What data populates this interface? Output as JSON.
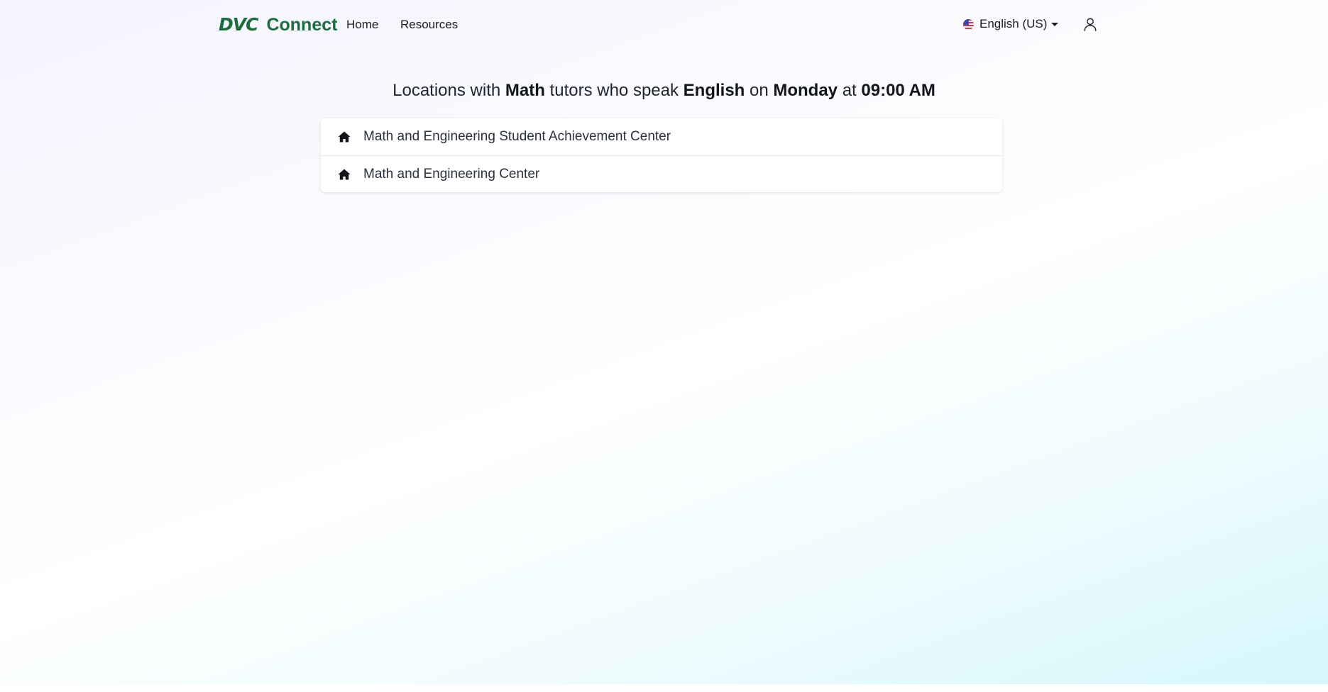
{
  "header": {
    "logo_text": "DVC",
    "brand_name": "Connect",
    "nav": {
      "home": "Home",
      "resources": "Resources"
    },
    "language": {
      "label": "English (US)",
      "flag_icon": "us-flag-icon"
    },
    "user_icon": "user-icon"
  },
  "heading": {
    "prefix": "Locations with ",
    "subject": "Math",
    "mid1": " tutors who speak ",
    "language": "English",
    "mid2": " on ",
    "day": "Monday",
    "mid3": " at ",
    "time": "09:00 AM"
  },
  "locations": [
    {
      "label": "Math and Engineering Student Achievement Center",
      "icon": "home-icon"
    },
    {
      "label": "Math and Engineering Center",
      "icon": "home-icon"
    }
  ],
  "colors": {
    "brand": "#1e6d3f",
    "text": "#1f2530"
  }
}
